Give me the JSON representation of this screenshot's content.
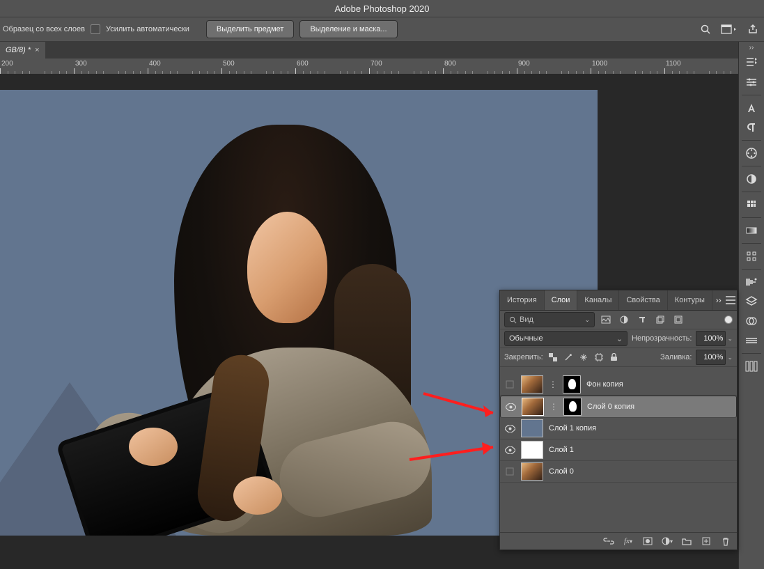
{
  "app": {
    "title": "Adobe Photoshop 2020"
  },
  "options_bar": {
    "sample_label": "Образец со всех слоев",
    "auto_label": "Усилить автоматически",
    "select_subject": "Выделить предмет",
    "select_mask": "Выделение и маска..."
  },
  "document": {
    "tab_label": "GB/8) *"
  },
  "ruler": {
    "start": 200,
    "step": 50,
    "major": 100,
    "count": 21
  },
  "panel": {
    "tabs": [
      "История",
      "Слои",
      "Каналы",
      "Свойства",
      "Контуры"
    ],
    "active_tab": 1,
    "search_placeholder": "Вид",
    "blend_mode": "Обычные",
    "opacity_label": "Непрозрачность:",
    "opacity_value": "100%",
    "lock_label": "Закрепить:",
    "fill_label": "Заливка:",
    "fill_value": "100%",
    "layers": [
      {
        "visible": false,
        "thumb": "photo",
        "mask": true,
        "name": "Фон копия"
      },
      {
        "visible": true,
        "thumb": "photo",
        "mask": true,
        "name": "Слой 0 копия",
        "selected": true
      },
      {
        "visible": true,
        "thumb": "blue",
        "mask": false,
        "name": "Слой 1 копия"
      },
      {
        "visible": true,
        "thumb": "white",
        "mask": false,
        "name": "Слой 1"
      },
      {
        "visible": false,
        "thumb": "photo",
        "mask": false,
        "name": "Слой 0"
      }
    ]
  }
}
